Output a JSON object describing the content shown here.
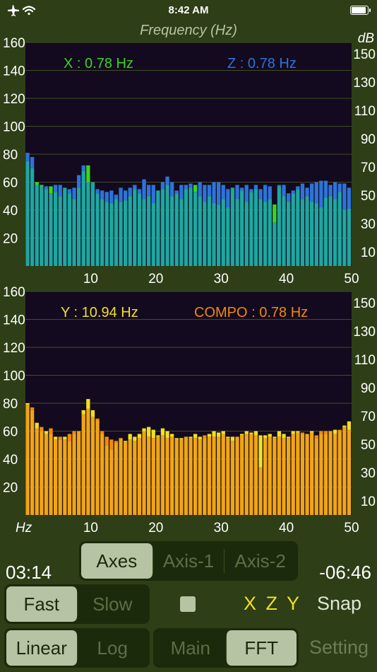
{
  "status": {
    "time": "8:42 AM"
  },
  "titles": {
    "frequency": "Frequency (Hz)",
    "db": "dB"
  },
  "top_chart": {
    "label_x": "X : 0.78 Hz",
    "label_z": "Z : 0.78 Hz",
    "color_x": "#39d61d",
    "color_z": "#2d73d8"
  },
  "bottom_chart": {
    "label_y": "Y : 10.94 Hz",
    "label_compo": "COMPO : 0.78 Hz",
    "color_y": "#f0e021",
    "color_compo": "#f08a0c",
    "x_unit": "Hz"
  },
  "chart_data": [
    {
      "type": "bar",
      "x_ticks": [
        10,
        20,
        30,
        40,
        50
      ],
      "y_ticks_left": [
        20,
        40,
        60,
        80,
        100,
        120,
        140,
        160
      ],
      "y_ticks_right": [
        10,
        30,
        50,
        70,
        90,
        110,
        130,
        150
      ],
      "ylim": [
        0,
        160
      ],
      "xlim": [
        0,
        50
      ],
      "series": [
        {
          "name": "X : 0.78 Hz",
          "color": "#39d61d",
          "values": [
            75,
            70,
            60,
            58,
            55,
            57,
            53,
            50,
            56,
            52,
            48,
            56,
            68,
            72,
            60,
            52,
            48,
            46,
            45,
            48,
            46,
            47,
            50,
            55,
            52,
            48,
            50,
            45,
            54,
            55,
            58,
            50,
            52,
            48,
            55,
            56,
            58,
            50,
            46,
            50,
            45,
            44,
            48,
            42,
            56,
            48,
            54,
            46,
            53,
            55,
            48,
            46,
            48,
            44,
            57,
            50,
            46,
            52,
            55,
            48,
            50,
            46,
            45,
            42,
            49,
            50,
            48,
            53,
            40,
            41
          ]
        },
        {
          "name": "Z : 0.78 Hz",
          "color": "#2d73d8",
          "values": [
            81,
            78,
            58,
            57,
            57,
            52,
            58,
            58,
            56,
            55,
            56,
            65,
            72,
            60,
            60,
            55,
            54,
            53,
            54,
            51,
            56,
            54,
            56,
            58,
            55,
            62,
            58,
            58,
            54,
            60,
            64,
            60,
            54,
            58,
            58,
            59,
            53,
            60,
            58,
            58,
            60,
            60,
            58,
            55,
            56,
            58,
            56,
            58,
            55,
            58,
            55,
            58,
            57,
            31,
            58,
            58,
            52,
            54,
            57,
            59,
            56,
            59,
            60,
            61,
            61,
            58,
            60,
            59,
            59,
            56
          ]
        },
        {
          "name": "Y : 10.94 Hz",
          "color": "#f0e021",
          "values": [
            80,
            75,
            66,
            60,
            60,
            58,
            56,
            54,
            56,
            53,
            58,
            60,
            75,
            83,
            75,
            68,
            58,
            50,
            47,
            52,
            55,
            53,
            58,
            56,
            58,
            62,
            63,
            61,
            57,
            62,
            60,
            58,
            55,
            55,
            56,
            56,
            58,
            56,
            55,
            58,
            60,
            59,
            60,
            56,
            56,
            56,
            58,
            60,
            59,
            60,
            57,
            57,
            58,
            56,
            60,
            58,
            56,
            60,
            60,
            58,
            58,
            60,
            55,
            58,
            58,
            60,
            61,
            60,
            64,
            67
          ]
        },
        {
          "name": "COMPO : 0.78 Hz",
          "color": "#f08a0c",
          "values": [
            79,
            77,
            62,
            63,
            58,
            62,
            54,
            56,
            54,
            58,
            60,
            60,
            72,
            76,
            70,
            69,
            60,
            56,
            54,
            53,
            55,
            52,
            54,
            53,
            55,
            60,
            56,
            55,
            56,
            57,
            55,
            56,
            54,
            54,
            56,
            55,
            55,
            54,
            57,
            56,
            56,
            56,
            58,
            55,
            53,
            56,
            57,
            58,
            58,
            57,
            34,
            55,
            56,
            55,
            56,
            55,
            55,
            58,
            59,
            59,
            58,
            59,
            57,
            60,
            60,
            60,
            58,
            61,
            63,
            61
          ]
        }
      ]
    }
  ],
  "controls": {
    "axes_tabs": [
      {
        "label": "Axes",
        "selected": true
      },
      {
        "label": "Axis-1",
        "selected": false
      },
      {
        "label": "Axis-2",
        "selected": false
      }
    ],
    "elapsed": "03:14",
    "remaining": "-06:46",
    "speed_tabs": [
      {
        "label": "Fast",
        "selected": true
      },
      {
        "label": "Slow",
        "selected": false
      }
    ],
    "axis_order": "X Z Y",
    "snap": "Snap",
    "scale_tabs": [
      {
        "label": "Linear",
        "selected": true
      },
      {
        "label": "Log",
        "selected": false
      }
    ],
    "view_tabs": [
      {
        "label": "Main",
        "selected": false
      },
      {
        "label": "FFT",
        "selected": true
      }
    ],
    "setting": "Setting",
    "colors": {
      "xzy": "#f0e021",
      "snap": "#dfe6d5",
      "setting": "#6d7d55"
    }
  }
}
